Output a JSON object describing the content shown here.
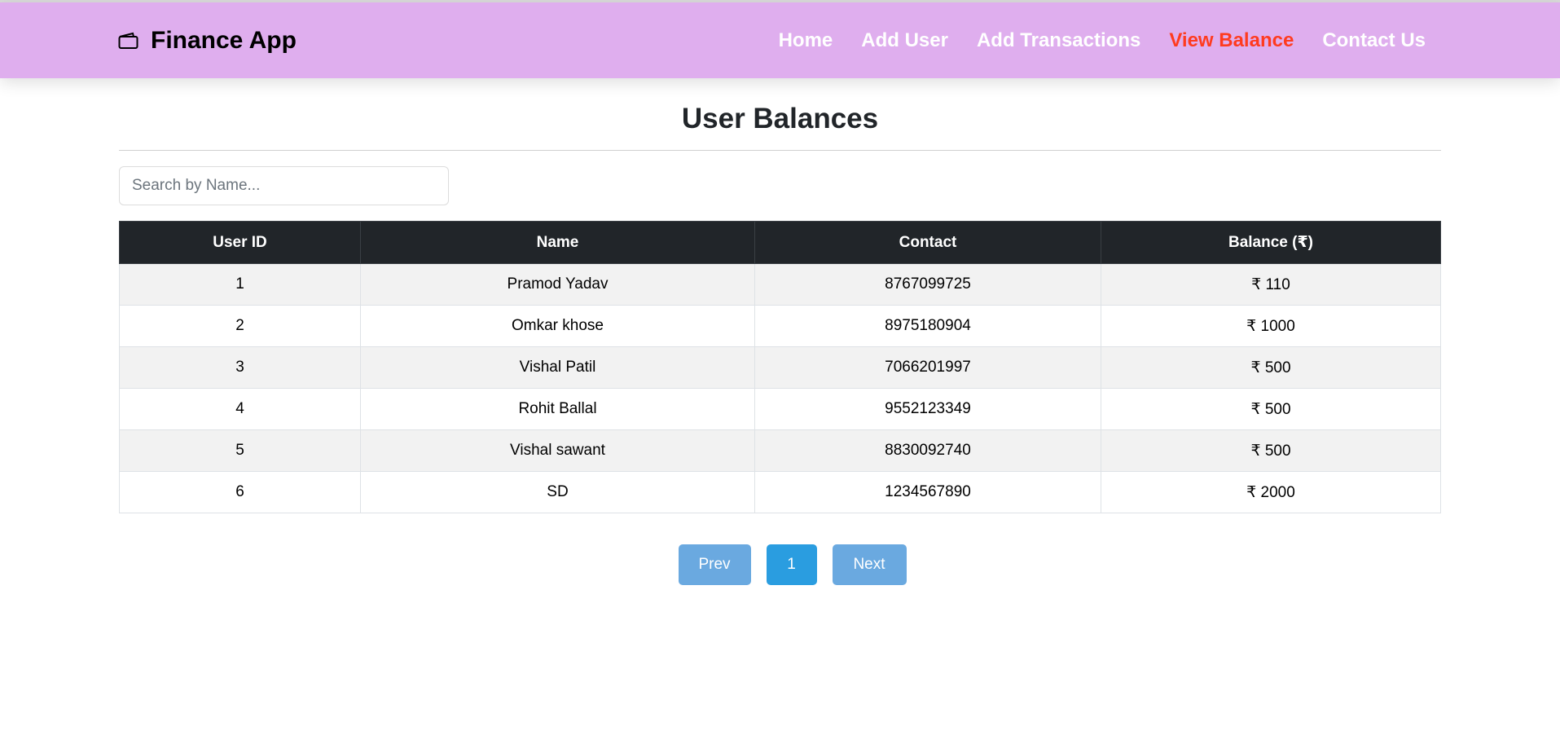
{
  "navbar": {
    "brand": "Finance App",
    "links": [
      "Home",
      "Add User",
      "Add Transactions",
      "View Balance",
      "Contact Us"
    ],
    "active_link": "View Balance"
  },
  "main": {
    "title": "User Balances",
    "search": {
      "placeholder": "Search by Name..."
    },
    "table": {
      "headers": [
        "User ID",
        "Name",
        "Contact",
        "Balance (₹)"
      ],
      "rows": [
        [
          "1",
          "Pramod Yadav",
          "8767099725",
          "₹ 110"
        ],
        [
          "2",
          "Omkar khose",
          "8975180904",
          "₹ 1000"
        ],
        [
          "3",
          "Vishal Patil",
          "7066201997",
          "₹ 500"
        ],
        [
          "4",
          "Rohit Ballal",
          "9552123349",
          "₹ 500"
        ],
        [
          "5",
          "Vishal sawant",
          "8830092740",
          "₹ 500"
        ],
        [
          "6",
          "SD",
          "1234567890",
          "₹ 2000"
        ]
      ]
    },
    "pagination": {
      "prev": "Prev",
      "current": "1",
      "next": "Next"
    }
  },
  "colors": {
    "navbar_bg": "#dfaeee",
    "active_link": "#ff3b1f",
    "table_header_bg": "#212529",
    "pagination_active": "#2a9de0",
    "pagination_inactive": "#6aa9e0"
  },
  "icons": {
    "brand_icon": "wallet-icon"
  }
}
